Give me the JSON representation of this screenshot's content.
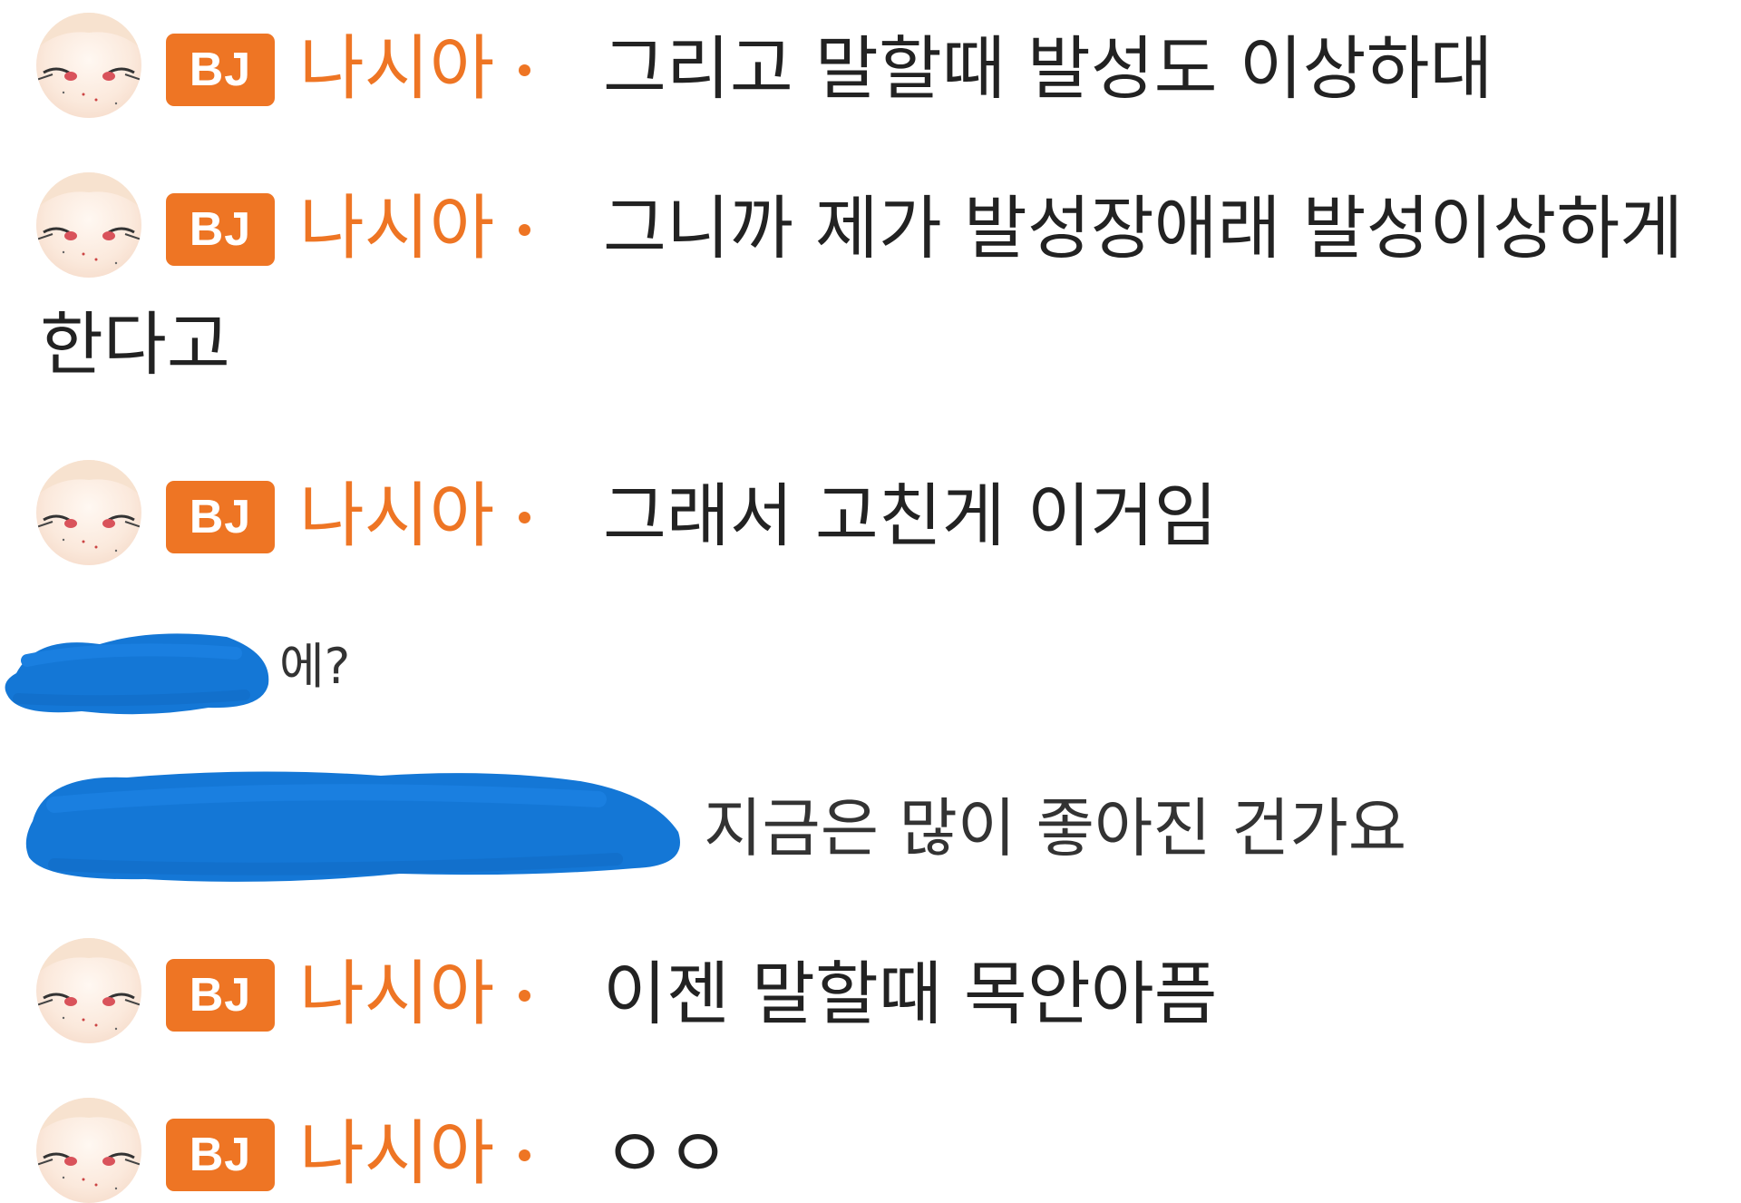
{
  "streamer": {
    "badge": "BJ",
    "nickname": "나시아",
    "badge_color": "#ee7524",
    "nick_color": "#ee7524"
  },
  "messages": [
    {
      "type": "bj",
      "text": "그리고 말할때 발성도 이상하대"
    },
    {
      "type": "bj",
      "text": "그니까 제가 발성장애래 발성이상하게",
      "continuation": "한다고"
    },
    {
      "type": "bj",
      "text": "그래서 고친게 이거임"
    },
    {
      "type": "viewer",
      "text": "에?"
    },
    {
      "type": "viewer",
      "text": "지금은 많이 좋아진 건가요"
    },
    {
      "type": "bj",
      "text": "이젠 말할때 목안아픔"
    },
    {
      "type": "bj",
      "text": "ㅇㅇ"
    }
  ],
  "redaction_color": "#1477d6"
}
